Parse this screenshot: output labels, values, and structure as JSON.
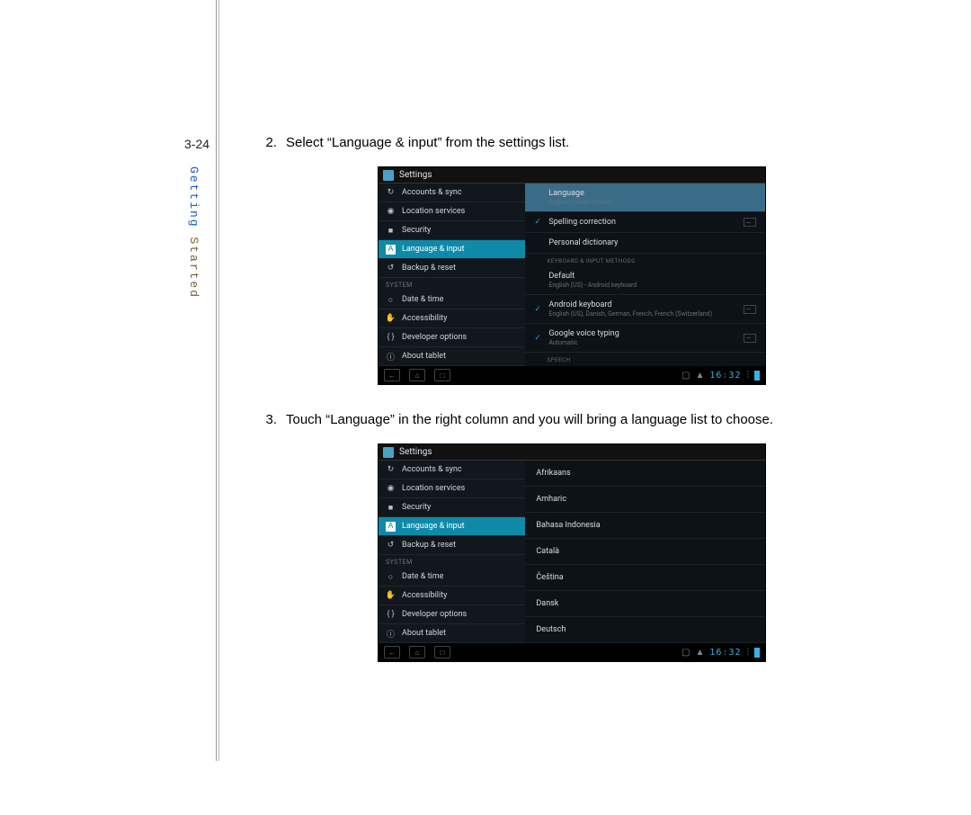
{
  "page_number": "3-24",
  "side_title": {
    "first": "Getting ",
    "second": "Started"
  },
  "steps": [
    {
      "num": "2.",
      "text": "Select “Language & input” from the settings list."
    },
    {
      "num": "3.",
      "text": "Touch “Language” in the right column and you will bring a language list to choose."
    }
  ],
  "shot1": {
    "title": "Settings",
    "left_menu": {
      "items": [
        {
          "label": "Accounts & sync",
          "icon": "↻"
        },
        {
          "label": "Location services",
          "icon": "◉"
        },
        {
          "label": "Security",
          "icon": "■"
        },
        {
          "label": "Language & input",
          "icon": "A",
          "selected": true
        },
        {
          "label": "Backup & reset",
          "icon": "↺"
        }
      ],
      "section": "SYSTEM",
      "system_items": [
        {
          "label": "Date & time",
          "icon": "○"
        },
        {
          "label": "Accessibility",
          "icon": "✋"
        },
        {
          "label": "Developer options",
          "icon": "{ }"
        },
        {
          "label": "About tablet",
          "icon": "ⓘ"
        }
      ]
    },
    "right": {
      "top": {
        "title": "Language",
        "sub": "English (United States)"
      },
      "spelling": {
        "title": "Spelling correction"
      },
      "personal": {
        "title": "Personal dictionary"
      },
      "section1": "KEYBOARD & INPUT METHODS",
      "default": {
        "title": "Default",
        "sub": "English (US) - Android keyboard"
      },
      "android_kb": {
        "title": "Android keyboard",
        "sub": "English (US), Danish, German, French, French (Switzerland)"
      },
      "voice": {
        "title": "Google voice typing",
        "sub": "Automatic"
      },
      "section2": "SPEECH"
    },
    "status": {
      "clock_h": "16",
      "clock_m": "32"
    }
  },
  "shot2": {
    "title": "Settings",
    "left_menu": {
      "items": [
        {
          "label": "Accounts & sync",
          "icon": "↻"
        },
        {
          "label": "Location services",
          "icon": "◉"
        },
        {
          "label": "Security",
          "icon": "■"
        },
        {
          "label": "Language & input",
          "icon": "A",
          "selected": true
        },
        {
          "label": "Backup & reset",
          "icon": "↺"
        }
      ],
      "section": "SYSTEM",
      "system_items": [
        {
          "label": "Date & time",
          "icon": "○"
        },
        {
          "label": "Accessibility",
          "icon": "✋"
        },
        {
          "label": "Developer options",
          "icon": "{ }"
        },
        {
          "label": "About tablet",
          "icon": "ⓘ"
        }
      ]
    },
    "languages": [
      "Afrikaans",
      "Amharic",
      "Bahasa Indonesia",
      "Català",
      "Čeština",
      "Dansk",
      "Deutsch"
    ],
    "status": {
      "clock_h": "16",
      "clock_m": "32"
    }
  }
}
